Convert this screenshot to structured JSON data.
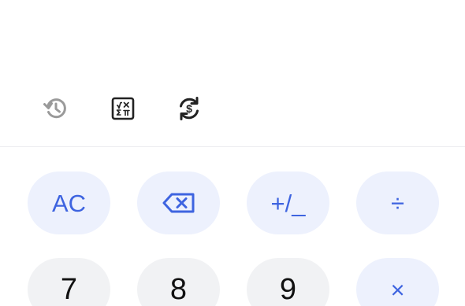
{
  "toolbar": {
    "history_icon": "history-icon",
    "scientific_icon": "scientific-functions-icon",
    "currency_icon": "currency-convert-icon"
  },
  "keypad": {
    "row1": {
      "clear": "AC",
      "backspace_icon": "backspace-icon",
      "sign": "+/_",
      "divide": "÷"
    },
    "row2": {
      "seven": "7",
      "eight": "8",
      "nine": "9",
      "multiply": "×"
    }
  },
  "colors": {
    "operator_bg": "#edf1fd",
    "operator_fg": "#3e64e0",
    "number_bg": "#f1f2f4",
    "number_fg": "#111111",
    "icon_gray": "#9a9a9a",
    "icon_dark": "#222222"
  }
}
